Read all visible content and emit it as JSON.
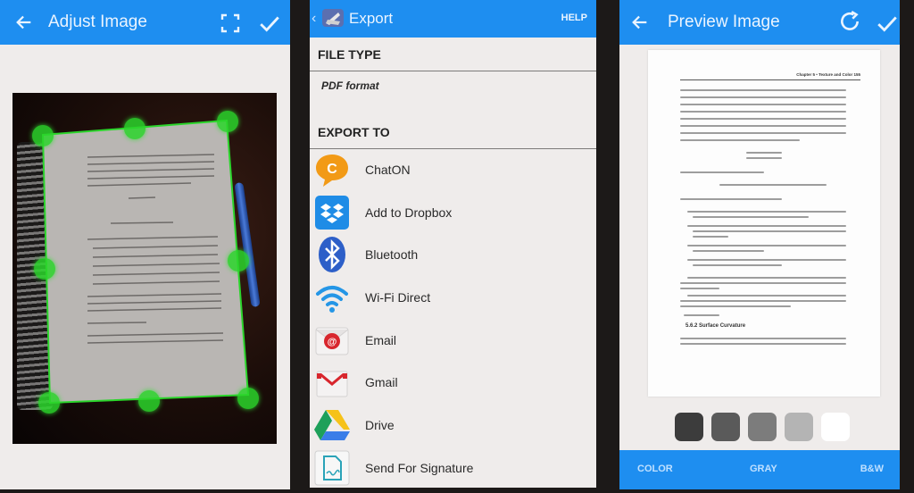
{
  "adjust_screen": {
    "title": "Adjust Image",
    "icons": {
      "back": "arrow-left-icon",
      "crop": "full-frame-crop-icon",
      "confirm": "checkmark-icon"
    },
    "handle_color": "#2bd52b"
  },
  "export_screen": {
    "title": "Export",
    "help_label": "HELP",
    "file_type_heading": "FILE TYPE",
    "file_type_value": "PDF format",
    "export_to_heading": "EXPORT TO",
    "targets": [
      {
        "label": "ChatON",
        "icon": "chaton-icon"
      },
      {
        "label": "Add to Dropbox",
        "icon": "dropbox-icon"
      },
      {
        "label": "Bluetooth",
        "icon": "bluetooth-icon"
      },
      {
        "label": "Wi-Fi Direct",
        "icon": "wifi-direct-icon"
      },
      {
        "label": "Email",
        "icon": "email-icon"
      },
      {
        "label": "Gmail",
        "icon": "gmail-icon"
      },
      {
        "label": "Drive",
        "icon": "drive-icon"
      },
      {
        "label": "Send For Signature",
        "icon": "signature-icon"
      }
    ]
  },
  "preview_screen": {
    "title": "Preview Image",
    "page_header": "Chapter 5 • Texture and Color   155",
    "section_heading": "5.6.2   Surface Curvature",
    "swatches": [
      "#3c3c3c",
      "#5a5a5a",
      "#7c7c7c",
      "#b4b4b4",
      "#ffffff"
    ],
    "modes": {
      "color": "COLOR",
      "gray": "GRAY",
      "bw": "B&W"
    }
  },
  "colors": {
    "accent": "#1e8ef0",
    "background": "#efeceb",
    "bezel": "#1c1918"
  }
}
